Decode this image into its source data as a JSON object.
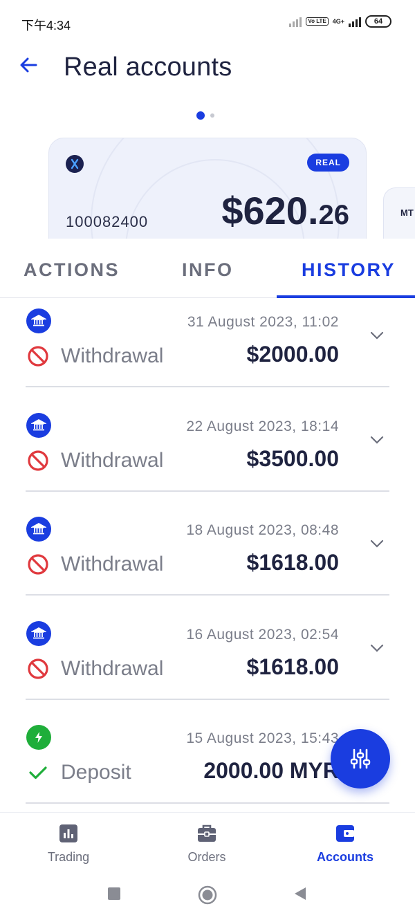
{
  "status_bar": {
    "time": "下午4:34",
    "network": "4G+",
    "volte": "Vo LTE",
    "battery": "64"
  },
  "header": {
    "title": "Real accounts"
  },
  "carousel": {
    "active_index": 0,
    "page_count": 2,
    "card": {
      "badge": "REAL",
      "account_number": "100082400",
      "balance_main": "$620.",
      "balance_cents": "26"
    },
    "next_card_label": "MT"
  },
  "tabs": [
    {
      "label": "ACTIONS",
      "active": false
    },
    {
      "label": "INFO",
      "active": false
    },
    {
      "label": "HISTORY",
      "active": true
    }
  ],
  "history": [
    {
      "method_icon": "bank-icon",
      "status_icon": "prohibited-icon",
      "type": "Withdrawal",
      "date": "31 August 2023, 11:02",
      "amount": "$2000.00"
    },
    {
      "method_icon": "bank-icon",
      "status_icon": "prohibited-icon",
      "type": "Withdrawal",
      "date": "22 August 2023, 18:14",
      "amount": "$3500.00"
    },
    {
      "method_icon": "bank-icon",
      "status_icon": "prohibited-icon",
      "type": "Withdrawal",
      "date": "18 August 2023, 08:48",
      "amount": "$1618.00"
    },
    {
      "method_icon": "bank-icon",
      "status_icon": "prohibited-icon",
      "type": "Withdrawal",
      "date": "16 August 2023, 02:54",
      "amount": "$1618.00"
    },
    {
      "method_icon": "lightning-icon",
      "status_icon": "checkmark-icon",
      "type": "Deposit",
      "date": "15 August 2023, 15:43",
      "amount": "2000.00 MYR"
    }
  ],
  "bottom_nav": [
    {
      "label": "Trading",
      "icon": "bar-chart-icon",
      "active": false
    },
    {
      "label": "Orders",
      "icon": "briefcase-icon",
      "active": false
    },
    {
      "label": "Accounts",
      "icon": "wallet-icon",
      "active": true
    }
  ],
  "colors": {
    "accent": "#1a3de0",
    "text_dark": "#1f2340",
    "text_muted": "#7b7e8a",
    "danger": "#e0393e",
    "success": "#1fae3a"
  }
}
